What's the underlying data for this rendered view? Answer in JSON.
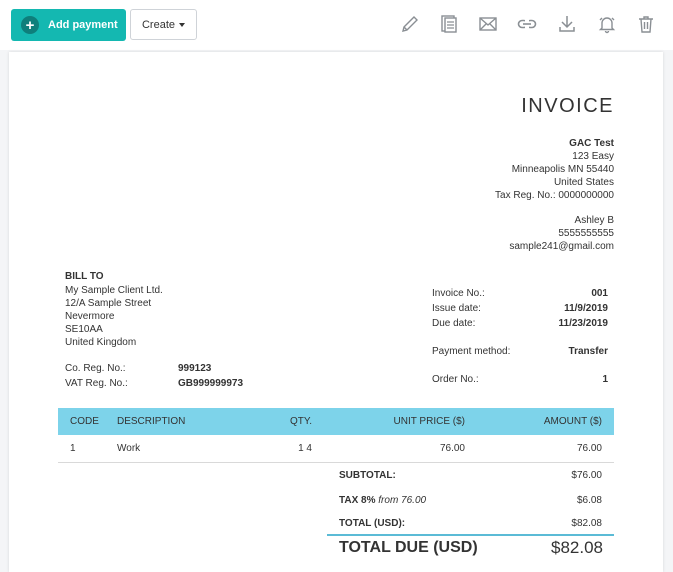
{
  "toolbar": {
    "add_payment_label": "Add payment",
    "add_payment_icon": "+",
    "create_label": "Create",
    "icons": [
      "pencil-icon",
      "copy-document-icon",
      "mail-icon",
      "link-icon",
      "download-icon",
      "bell-reminder-icon",
      "trash-icon"
    ]
  },
  "invoice": {
    "title": "INVOICE",
    "company": {
      "name": "GAC Test",
      "address1": "123 Easy",
      "address2": "Minneapolis MN 55440",
      "country": "United States",
      "tax_reg": "Tax Reg. No.: 0000000000",
      "contact_name": "Ashley B",
      "phone": "5555555555",
      "email": "sample241@gmail.com"
    },
    "bill_to": {
      "heading": "BILL TO",
      "lines": [
        "My Sample Client Ltd.",
        "12/A Sample Street",
        "Nevermore",
        "SE10AA",
        "United Kingdom"
      ],
      "co_reg_label": "Co. Reg. No.:",
      "co_reg_value": "999123",
      "vat_reg_label": "VAT Reg. No.:",
      "vat_reg_value": "GB999999973"
    },
    "meta": {
      "invoice_no_label": "Invoice No.:",
      "invoice_no_value": "001",
      "issue_date_label": "Issue date:",
      "issue_date_value": "11/9/2019",
      "due_date_label": "Due date:",
      "due_date_value": "11/23/2019",
      "payment_method_label": "Payment method:",
      "payment_method_value": "Transfer",
      "order_no_label": "Order No.:",
      "order_no_value": "1"
    },
    "table": {
      "headers": {
        "code": "CODE",
        "description": "DESCRIPTION",
        "qty": "QTY.",
        "unit_price": "UNIT PRICE ($)",
        "amount": "AMOUNT ($)"
      },
      "rows": [
        {
          "code": "1",
          "description": "Work",
          "qty": "1 4",
          "unit_price": "76.00",
          "amount": "76.00"
        }
      ]
    },
    "totals": {
      "subtotal_label": "SUBTOTAL:",
      "subtotal_value": "$76.00",
      "tax_label": "TAX 8%",
      "tax_from": "from 76.00",
      "tax_value": "$6.08",
      "total_label": "TOTAL (USD):",
      "total_value": "$82.08",
      "total_due_label": "TOTAL DUE (USD)",
      "total_due_value": "$82.08"
    }
  },
  "colors": {
    "accent": "#14b8b1",
    "table_header": "#7dd3ea"
  }
}
